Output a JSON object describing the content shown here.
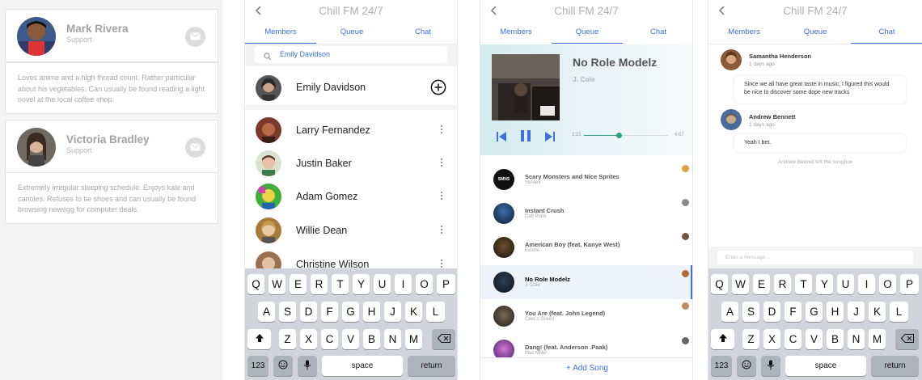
{
  "profiles": [
    {
      "name": "Mark Rivera",
      "role": "Support",
      "bio": "Loves anime and a high thread count. Rather particular about his vegetables. Can usually be found reading a light novel at the local coffee shop."
    },
    {
      "name": "Victoria Bradley",
      "role": "Support",
      "bio": "Extremely irregular sleeping schedule. Enjoys kale and canoles. Refuses to tie shoes and can usually be found browsing newegg for computer deals."
    }
  ],
  "app": {
    "title": "Chill FM 24/7",
    "tabs": [
      "Members",
      "Queue",
      "Chat"
    ]
  },
  "members_screen": {
    "search_value": "Emily Davidson",
    "search_result": "Emily Davidson",
    "members": [
      "Larry Fernandez",
      "Justin Baker",
      "Adam Gomez",
      "Willie Dean",
      "Christine Wilson"
    ]
  },
  "queue_screen": {
    "now_playing": {
      "title": "No Role Modelz",
      "artist": "J. Cole",
      "elapsed": "1:21",
      "duration": "4:07",
      "progress": 0.42
    },
    "queue": [
      {
        "title": "Scary Monsters and Nice Sprites",
        "artist": "Skrillex",
        "art_text": "SMNS"
      },
      {
        "title": "Instant Crush",
        "artist": "Daft Punk",
        "art_text": ""
      },
      {
        "title": "American Boy (feat. Kanye West)",
        "artist": "Estelle",
        "art_text": ""
      },
      {
        "title": "No Role Modelz",
        "artist": "J. Cole",
        "art_text": ""
      },
      {
        "title": "You Are (feat. John Legend)",
        "artist": "CeeLo Green",
        "art_text": ""
      },
      {
        "title": "Dang! (feat. Anderson .Paak)",
        "artist": "Mac Miller",
        "art_text": ""
      }
    ],
    "add_song": "+ Add Song"
  },
  "chat_screen": {
    "messages": [
      {
        "name": "Samantha Henderson",
        "time": "1 days ago",
        "text": "Since we all have great taste in music, I figured this would be nice to discover some dope new tracks"
      },
      {
        "name": "Andrew Bennett",
        "time": "1 days ago",
        "text": "Yeah I bet."
      }
    ],
    "system_notice": "Andrew Bennet left the songbox",
    "input_placeholder": "Enter a message..."
  },
  "keyboard": {
    "row1": [
      "Q",
      "W",
      "E",
      "R",
      "T",
      "Y",
      "U",
      "I",
      "O",
      "P"
    ],
    "row2": [
      "A",
      "S",
      "D",
      "F",
      "G",
      "H",
      "J",
      "K",
      "L"
    ],
    "row3": [
      "Z",
      "X",
      "C",
      "V",
      "B",
      "N",
      "M"
    ],
    "numbers": "123",
    "space": "space",
    "return": "return"
  },
  "colors": {
    "accent": "#3b72dc",
    "now_playing_bg": "#d5ebef",
    "keyboard_bg": "#d1d5db",
    "progress": "#2f9c86"
  },
  "icons": [
    "mail-icon",
    "back-chevron-icon",
    "search-icon",
    "add-circle-icon",
    "more-vertical-icon",
    "skip-previous-icon",
    "pause-icon",
    "skip-next-icon",
    "shift-icon",
    "backspace-icon",
    "emoji-icon",
    "microphone-icon"
  ]
}
